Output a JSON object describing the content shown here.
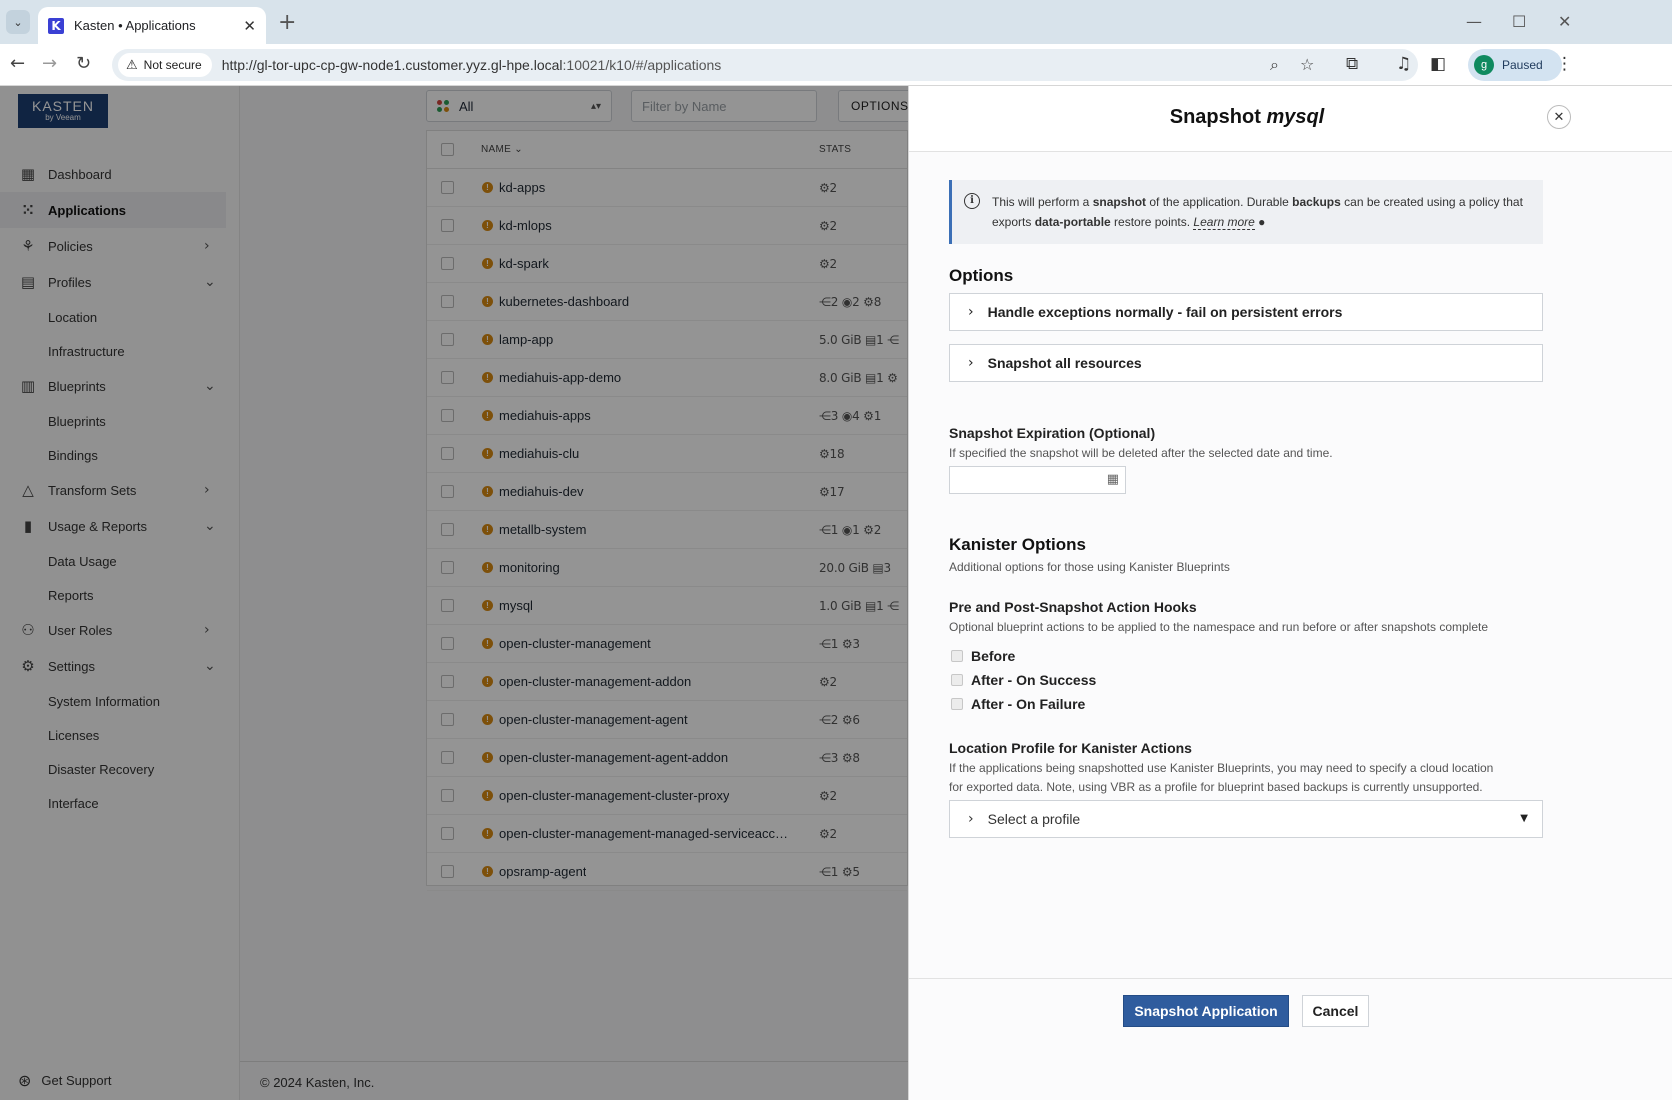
{
  "browser": {
    "tab_title": "Kasten • Applications",
    "tab_favicon_letter": "K",
    "security_label": "Not secure",
    "url_host": "http://gl-tor-upc-cp-gw-node1.customer.yyz.gl-hpe.local",
    "url_rest": ":10021/k10/#/applications",
    "profile_initial": "g",
    "profile_status": "Paused"
  },
  "logo": {
    "line1": "KASTEN",
    "line2": "by Veeam"
  },
  "sidebar": {
    "dashboard": "Dashboard",
    "applications": "Applications",
    "policies": "Policies",
    "profiles": "Profiles",
    "location": "Location",
    "infrastructure": "Infrastructure",
    "blueprints_group": "Blueprints",
    "blueprints": "Blueprints",
    "bindings": "Bindings",
    "transform_sets": "Transform Sets",
    "usage_reports": "Usage & Reports",
    "data_usage": "Data Usage",
    "reports": "Reports",
    "user_roles": "User Roles",
    "settings": "Settings",
    "system_information": "System Information",
    "licenses": "Licenses",
    "disaster_recovery": "Disaster Recovery",
    "interface": "Interface",
    "get_support": "Get Support"
  },
  "footer": {
    "copyright": "© 2024 Kasten, Inc."
  },
  "filters": {
    "namespace_filter": "All",
    "name_placeholder": "Filter by Name",
    "options_label": "OPTIONS"
  },
  "table": {
    "col_name": "NAME",
    "col_stats": "STATS",
    "rows": [
      {
        "name": "kd-apps",
        "stats": "⚙2"
      },
      {
        "name": "kd-mlops",
        "stats": "⚙2"
      },
      {
        "name": "kd-spark",
        "stats": "⚙2"
      },
      {
        "name": "kubernetes-dashboard",
        "stats": "⋲2  ◉2  ⚙8"
      },
      {
        "name": "lamp-app",
        "stats": "5.0 GiB  ▤1  ⋲"
      },
      {
        "name": "mediahuis-app-demo",
        "stats": "8.0 GiB  ▤1  ⚙"
      },
      {
        "name": "mediahuis-apps",
        "stats": "⋲3  ◉4  ⚙1"
      },
      {
        "name": "mediahuis-clu",
        "stats": "⚙18"
      },
      {
        "name": "mediahuis-dev",
        "stats": "⚙17"
      },
      {
        "name": "metallb-system",
        "stats": "⋲1  ◉1  ⚙2"
      },
      {
        "name": "monitoring",
        "stats": "20.0 GiB  ▤3"
      },
      {
        "name": "mysql",
        "stats": "1.0 GiB  ▤1  ⋲"
      },
      {
        "name": "open-cluster-management",
        "stats": "⋲1  ⚙3"
      },
      {
        "name": "open-cluster-management-addon",
        "stats": "⚙2"
      },
      {
        "name": "open-cluster-management-agent",
        "stats": "⋲2  ⚙6"
      },
      {
        "name": "open-cluster-management-agent-addon",
        "stats": "⋲3  ⚙8"
      },
      {
        "name": "open-cluster-management-cluster-proxy",
        "stats": "⚙2"
      },
      {
        "name": "open-cluster-management-managed-serviceacco...",
        "stats": "⚙2"
      },
      {
        "name": "opsramp-agent",
        "stats": "⋲1  ⚙5"
      }
    ]
  },
  "drawer": {
    "title_prefix": "Snapshot",
    "title_app": "mysql",
    "info": {
      "t1": "This will perform a ",
      "b1": "snapshot",
      "t2": " of the application. Durable ",
      "b2": "backups",
      "t3": " can be created using a policy that exports ",
      "b3": "data-portable",
      "t4": " restore points. ",
      "learn_more": "Learn more"
    },
    "options_heading": "Options",
    "exceptions_label": "Handle exceptions normally - fail on persistent errors",
    "resources_label": "Snapshot all resources",
    "expiration_heading": "Snapshot Expiration (Optional)",
    "expiration_desc": "If specified the snapshot will be deleted after the selected date and time.",
    "kanister_heading": "Kanister Options",
    "kanister_desc": "Additional options for those using Kanister Blueprints",
    "hooks_heading": "Pre and Post-Snapshot Action Hooks",
    "hooks_desc": "Optional blueprint actions to be applied to the namespace and run before or after snapshots complete",
    "hook_before": "Before",
    "hook_success": "After - On Success",
    "hook_failure": "After - On Failure",
    "location_heading": "Location Profile for Kanister Actions",
    "location_desc_1": "If the applications being snapshotted use Kanister Blueprints, you may need to specify a cloud location",
    "location_desc_2": "for exported data. Note, using VBR as a profile for blueprint based backups is currently unsupported.",
    "profile_placeholder": "Select a profile",
    "submit_label": "Snapshot Application",
    "cancel_label": "Cancel"
  },
  "colors": {
    "primary": "#2f5c9e",
    "warning": "#d88a12",
    "logo_bg": "#1d3f73",
    "info_border": "#3b6fb6"
  }
}
